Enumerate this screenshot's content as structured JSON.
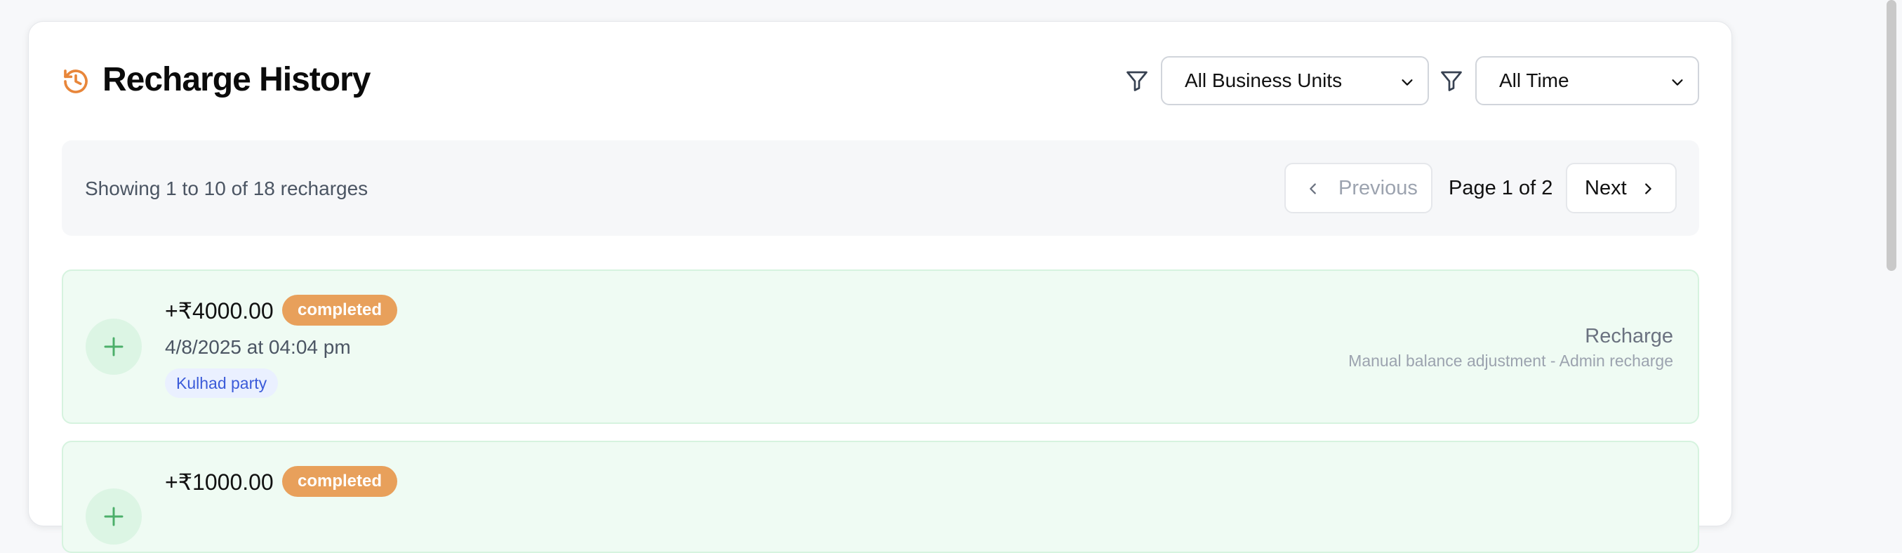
{
  "header": {
    "title": "Recharge History",
    "business_unit_filter": {
      "selected": "All Business Units"
    },
    "time_filter": {
      "selected": "All Time"
    }
  },
  "pagination": {
    "showing_text": "Showing 1 to 10 of 18 recharges",
    "previous_label": "Previous",
    "page_indicator": "Page 1 of 2",
    "next_label": "Next"
  },
  "transactions": [
    {
      "amount": "+₹4000.00",
      "status": "completed",
      "date": "4/8/2025 at 04:04 pm",
      "business_unit": "Kulhad party",
      "type": "Recharge",
      "description": "Manual balance adjustment - Admin recharge"
    },
    {
      "amount": "+₹1000.00",
      "status": "completed"
    }
  ],
  "colors": {
    "accent_orange": "#e8a05b",
    "history_icon": "#e8863a",
    "success_bg": "#effbf3",
    "plus_icon": "#4caf6a",
    "tag_text": "#3b5bd9"
  },
  "icons": {
    "history": "history-icon",
    "filter": "filter-icon",
    "chevron_down": "chevron-down-icon",
    "chevron_left": "chevron-left-icon",
    "chevron_right": "chevron-right-icon",
    "plus": "plus-icon"
  }
}
